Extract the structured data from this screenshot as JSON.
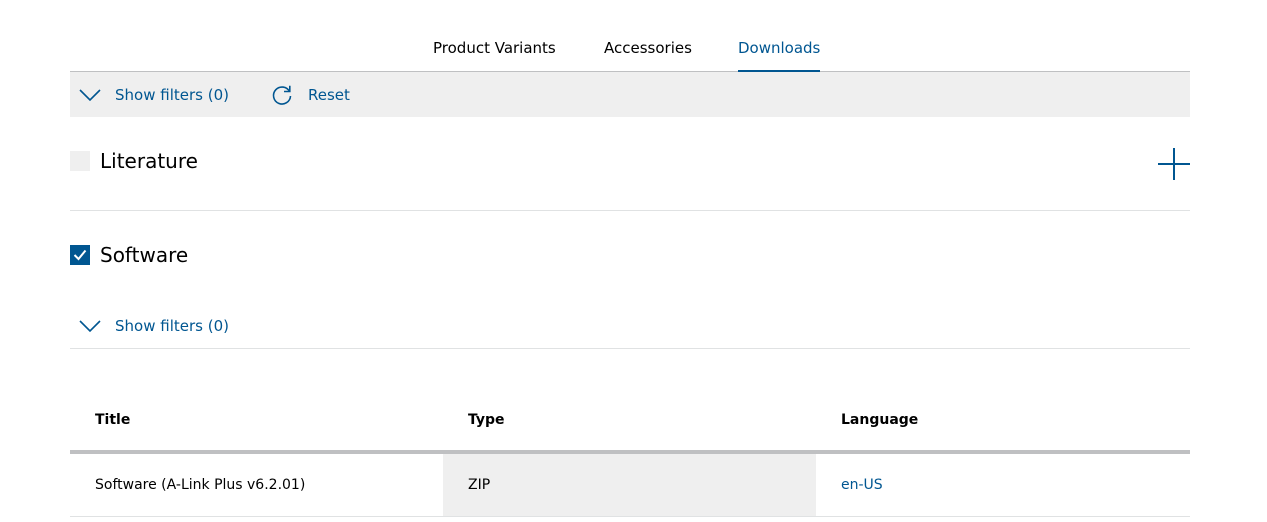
{
  "tabs": [
    {
      "label": "Product Variants",
      "active": false
    },
    {
      "label": "Accessories",
      "active": false
    },
    {
      "label": "Downloads",
      "active": true
    }
  ],
  "filterbar": {
    "show_filters_label": "Show filters (0)",
    "reset_label": "Reset"
  },
  "categories": [
    {
      "label": "Literature",
      "checked": false,
      "expand_icon": "plus-icon"
    },
    {
      "label": "Software",
      "checked": true
    }
  ],
  "software_filter": {
    "show_filters_label": "Show filters (0)"
  },
  "table": {
    "columns": [
      "Title",
      "Type",
      "Language"
    ],
    "rows": [
      {
        "title": "Software (A-Link Plus v6.2.01)",
        "type": "ZIP",
        "language": "en-US"
      }
    ]
  },
  "colors": {
    "accent": "#005691",
    "filter_bg": "#efefef",
    "divider": "#e0e2e3"
  }
}
